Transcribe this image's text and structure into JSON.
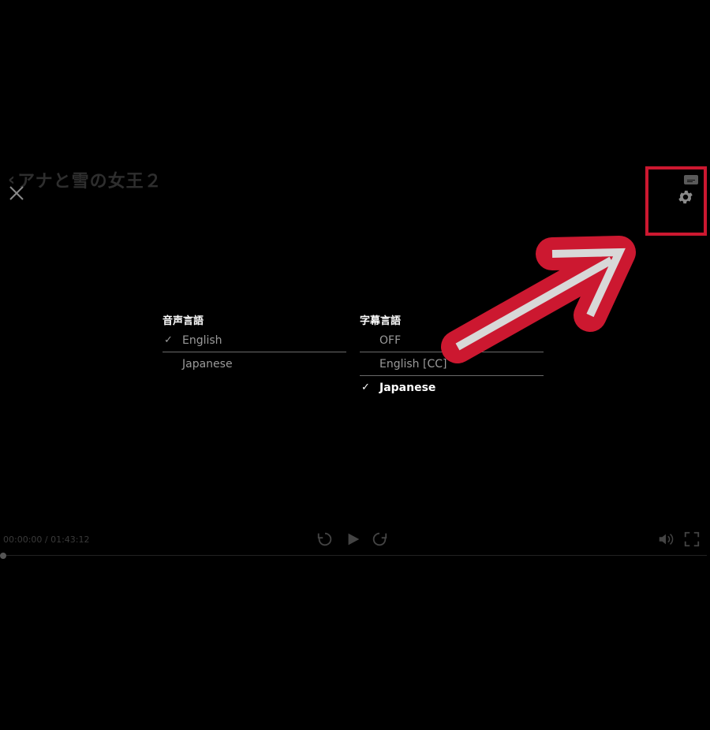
{
  "header": {
    "back_icon": "chevron-left-icon",
    "title": "アナと雪の女王２",
    "close_icon": "close-icon"
  },
  "top_controls": {
    "subtitle_icon": "subtitle-icon",
    "settings_icon": "gear-icon",
    "highlight_color": "#cc1830"
  },
  "audio_menu": {
    "heading": "音声言語",
    "options": [
      {
        "label": "English",
        "selected": true
      },
      {
        "label": "Japanese",
        "selected": false
      }
    ]
  },
  "subtitle_menu": {
    "heading": "字幕言語",
    "options": [
      {
        "label": "OFF",
        "selected": false
      },
      {
        "label": "English [CC]",
        "selected": false
      },
      {
        "label": "Japanese",
        "selected": true
      }
    ]
  },
  "player": {
    "time": "00:00:00 / 01:43:12",
    "progress": 0,
    "icons": [
      "rewind-icon",
      "play-icon",
      "forward-icon",
      "volume-icon",
      "fullscreen-icon"
    ]
  },
  "colors": {
    "background": "#000000",
    "arrow_outline": "#cc1830",
    "arrow_fill": "#d8d8d8"
  }
}
